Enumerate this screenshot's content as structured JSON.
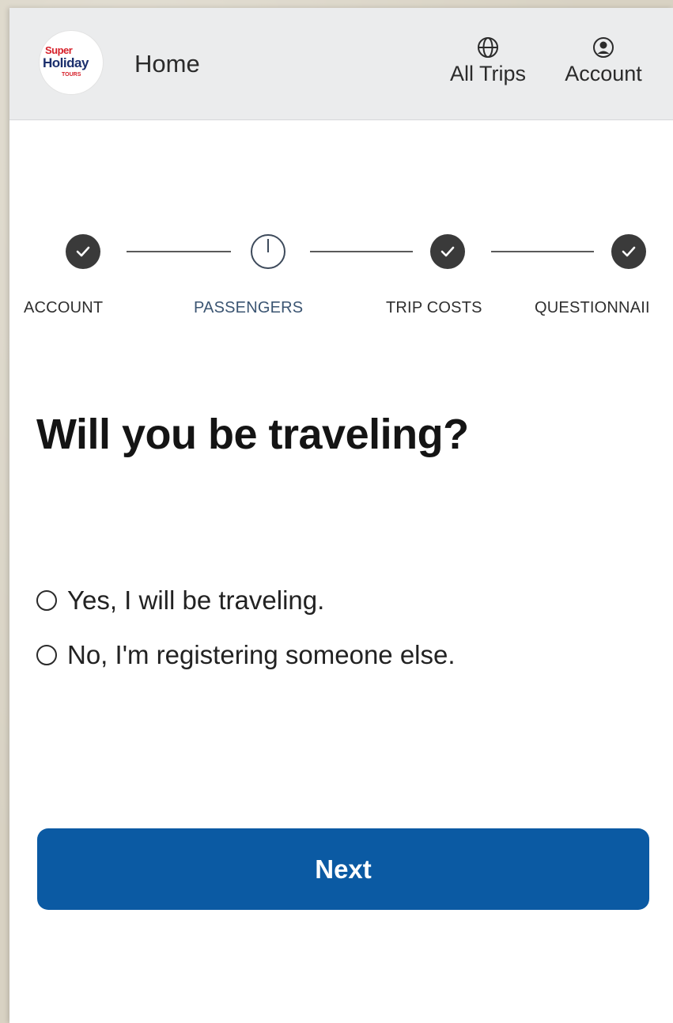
{
  "header": {
    "logo": {
      "line1": "Super",
      "line2": "Holiday",
      "line3": "TOURS"
    },
    "home_label": "Home",
    "nav": [
      {
        "label": "All Trips",
        "icon": "globe-icon"
      },
      {
        "label": "Account",
        "icon": "user-circle-icon"
      }
    ]
  },
  "stepper": {
    "steps": [
      {
        "label": "ACCOUNT",
        "status": "complete"
      },
      {
        "label": "PASSENGERS",
        "status": "current"
      },
      {
        "label": "TRIP COSTS",
        "status": "complete"
      },
      {
        "label": "QUESTIONNAII",
        "status": "complete"
      }
    ]
  },
  "main": {
    "title": "Will you be traveling?",
    "options": [
      {
        "label": "Yes, I will be traveling.",
        "selected": false
      },
      {
        "label": "No, I'm registering someone else.",
        "selected": false
      }
    ],
    "next_label": "Next"
  },
  "colors": {
    "primary_button": "#0b5aa3",
    "topbar_bg": "#ebeced",
    "active_step": "#3b5572"
  }
}
